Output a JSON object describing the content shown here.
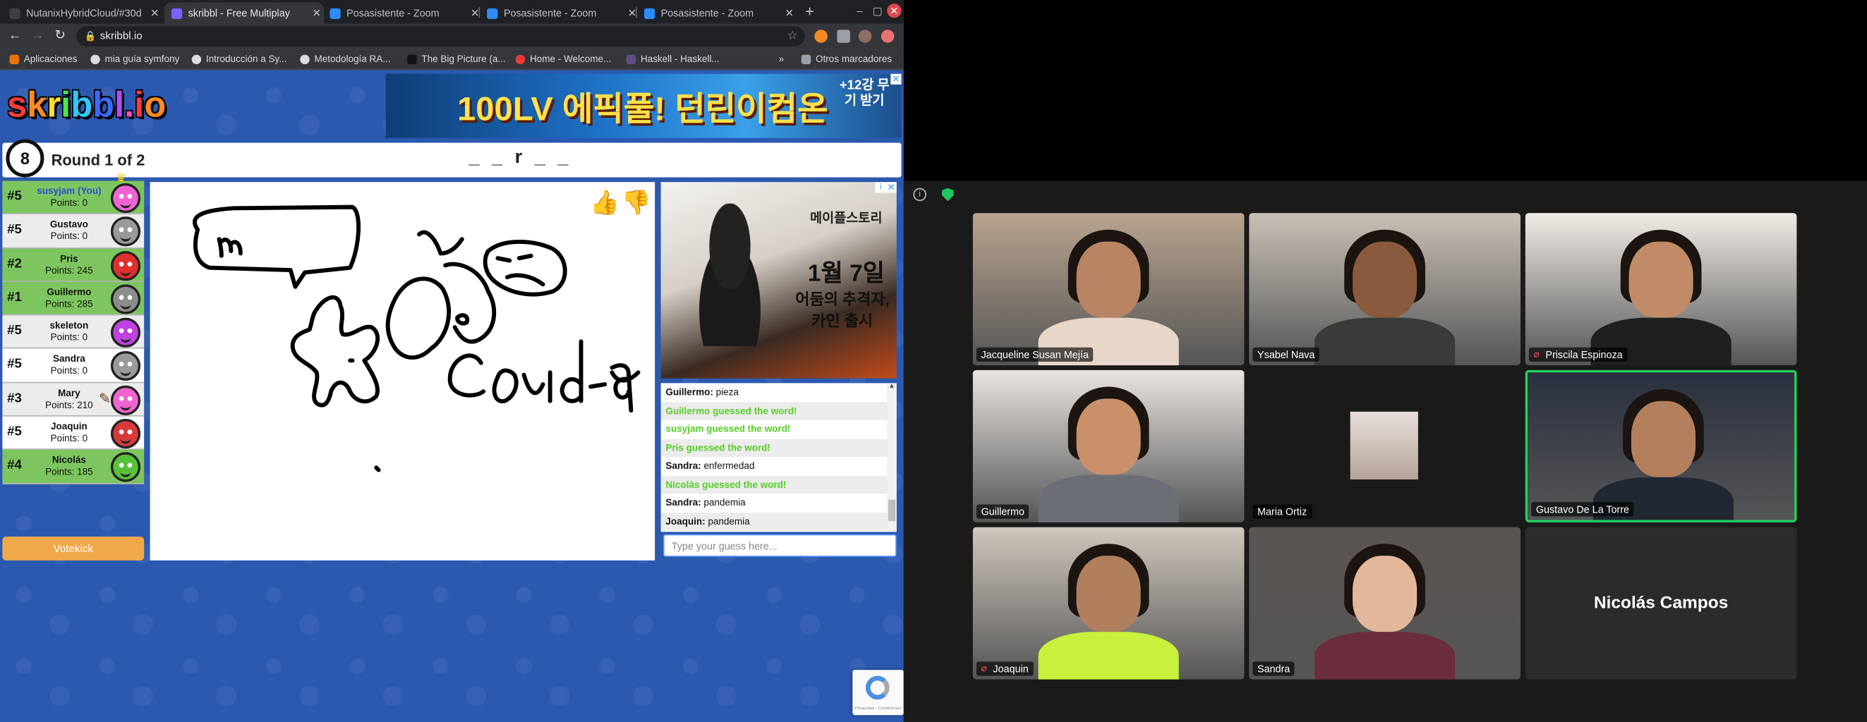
{
  "browser": {
    "tabs": [
      {
        "title": "NutanixHybridCloud/#30d",
        "active": false,
        "favicon_color": "#3c4043"
      },
      {
        "title": "skribbl - Free Multiplay",
        "active": true,
        "favicon_color": "#7b61ff"
      },
      {
        "title": "Posasistente - Zoom",
        "active": false,
        "favicon_color": "#2d8cff"
      },
      {
        "title": "Posasistente - Zoom",
        "active": false,
        "favicon_color": "#2d8cff"
      },
      {
        "title": "Posasistente - Zoom",
        "active": false,
        "favicon_color": "#2d8cff"
      }
    ],
    "new_tab": "+",
    "url": "skribbl.io",
    "bookmarks": [
      {
        "label": "Aplicaciones",
        "icon_color": "#e8710a"
      },
      {
        "label": "mia guía symfony",
        "icon_color": "#dadce0"
      },
      {
        "label": "Introducción a Sy...",
        "icon_color": "#dadce0"
      },
      {
        "label": "Metodología RA...",
        "icon_color": "#dadce0"
      },
      {
        "label": "The Big Picture (a...",
        "icon_color": "#111111"
      },
      {
        "label": "Home - Welcome...",
        "icon_color": "#e53935"
      },
      {
        "label": "Haskell - Haskell...",
        "icon_color": "#5e5086"
      }
    ],
    "more_bookmarks": "»",
    "other_bookmarks": "Otros marcadores"
  },
  "skribbl": {
    "logo": "skribbl.io",
    "logo_letters": [
      {
        "ch": "s",
        "color": "#ff3b3b"
      },
      {
        "ch": "k",
        "color": "#ff8a1f"
      },
      {
        "ch": "r",
        "color": "#ffe21f"
      },
      {
        "ch": "i",
        "color": "#4fe34a"
      },
      {
        "ch": "b",
        "color": "#2ec7ff"
      },
      {
        "ch": "b",
        "color": "#3a6bff"
      },
      {
        "ch": "l",
        "color": "#b34bff"
      },
      {
        "ch": ".",
        "color": "#ff4fb8"
      },
      {
        "ch": "i",
        "color": "#ff3b3b"
      },
      {
        "ch": "o",
        "color": "#ff8a1f"
      }
    ],
    "ad_banner_text": "100LV 에픽풀! 던린이컴온",
    "ad_banner_side": "+12강 무기 받기",
    "timer": "8",
    "round_label": "Round 1 of 2",
    "word_hint": "_ _ r _ _",
    "players": [
      {
        "rank": "#5",
        "name": "susyjam (You)",
        "points": "Points: 0",
        "bg": "#7dc65f",
        "avatar": "#f064d2",
        "you": true,
        "crown": true
      },
      {
        "rank": "#5",
        "name": "Gustavo",
        "points": "Points: 0",
        "bg": "#ececec",
        "avatar": "#9a9a9a"
      },
      {
        "rank": "#2",
        "name": "Pris",
        "points": "Points: 245",
        "bg": "#7dc65f",
        "avatar": "#e0302d"
      },
      {
        "rank": "#1",
        "name": "Guillermo",
        "points": "Points: 285",
        "bg": "#7dc65f",
        "avatar": "#8d8d8d"
      },
      {
        "rank": "#5",
        "name": "skeleton",
        "points": "Points: 0",
        "bg": "#ececec",
        "avatar": "#c043e0"
      },
      {
        "rank": "#5",
        "name": "Sandra",
        "points": "Points: 0",
        "bg": "#ffffff",
        "avatar": "#9a9a9a"
      },
      {
        "rank": "#3",
        "name": "Mary",
        "points": "Points: 210",
        "bg": "#ececec",
        "avatar": "#f064d2",
        "drawing": true
      },
      {
        "rank": "#5",
        "name": "Joaquin",
        "points": "Points: 0",
        "bg": "#ffffff",
        "avatar": "#d83a3a"
      },
      {
        "rank": "#4",
        "name": "Nicolás",
        "points": "Points: 185",
        "bg": "#7dc65f",
        "avatar": "#57c23a"
      }
    ],
    "votekick_label": "Votekick",
    "thumb_up": "👍",
    "thumb_down": "👎",
    "ad_side": {
      "t1": "메이플스토리",
      "t2": "1월 7일",
      "t3": "어둠의 추격자,",
      "t4": "카인 출시"
    },
    "chat": [
      {
        "user": "Guillermo:",
        "text": "pieza",
        "green": false
      },
      {
        "user": "",
        "text": "Guillermo guessed the word!",
        "green": true
      },
      {
        "user": "",
        "text": "susyjam guessed the word!",
        "green": true
      },
      {
        "user": "",
        "text": "Pris guessed the word!",
        "green": true
      },
      {
        "user": "Sandra:",
        "text": "enfermedad",
        "green": false
      },
      {
        "user": "",
        "text": "Nicolás guessed the word!",
        "green": true
      },
      {
        "user": "Sandra:",
        "text": "pandemia",
        "green": false
      },
      {
        "user": "Joaquin:",
        "text": "pandemia",
        "green": false
      }
    ],
    "guess_placeholder": "Type your guess here...",
    "recaptcha_text": "Privacidad - Condiciones"
  },
  "zoom": {
    "participants": [
      {
        "name": "Jacqueline Susan Mejía",
        "muted": false,
        "bg": "#b9a48f",
        "face": "#b88464",
        "shirt": "#e8d6c9"
      },
      {
        "name": "Ysabel Nava",
        "muted": false,
        "bg": "#c9c1b7",
        "face": "#8a5a3c",
        "shirt": "#3a3a3a"
      },
      {
        "name": "Priscila Espinoza",
        "muted": true,
        "bg": "#f1ece6",
        "face": "#c08b66",
        "shirt": "#1f1f1f"
      },
      {
        "name": "Guillermo",
        "muted": false,
        "bg": "#e9e4df",
        "face": "#c9906a",
        "shirt": "#6b6f75"
      },
      {
        "name": "Maria Ortiz",
        "muted": false,
        "bg": "#1a1a1a",
        "face": "#c8a58c",
        "shirt": "#222222",
        "thumbnail": true
      },
      {
        "name": "Gustavo De La Torre",
        "muted": false,
        "bg": "#2a3040",
        "face": "#b3805e",
        "shirt": "#222833",
        "active": true
      },
      {
        "name": "Joaquin",
        "muted": true,
        "bg": "#cfc7bd",
        "face": "#b07f5d",
        "shirt": "#c8f03c"
      },
      {
        "name": "Sandra",
        "muted": false,
        "bg": "#5b5552",
        "face": "#e3b79b",
        "shirt": "#6b2d3c"
      },
      {
        "name": "Nicolás Campos",
        "muted": false,
        "bg": "#1f1f1f",
        "video_off": true
      }
    ]
  }
}
